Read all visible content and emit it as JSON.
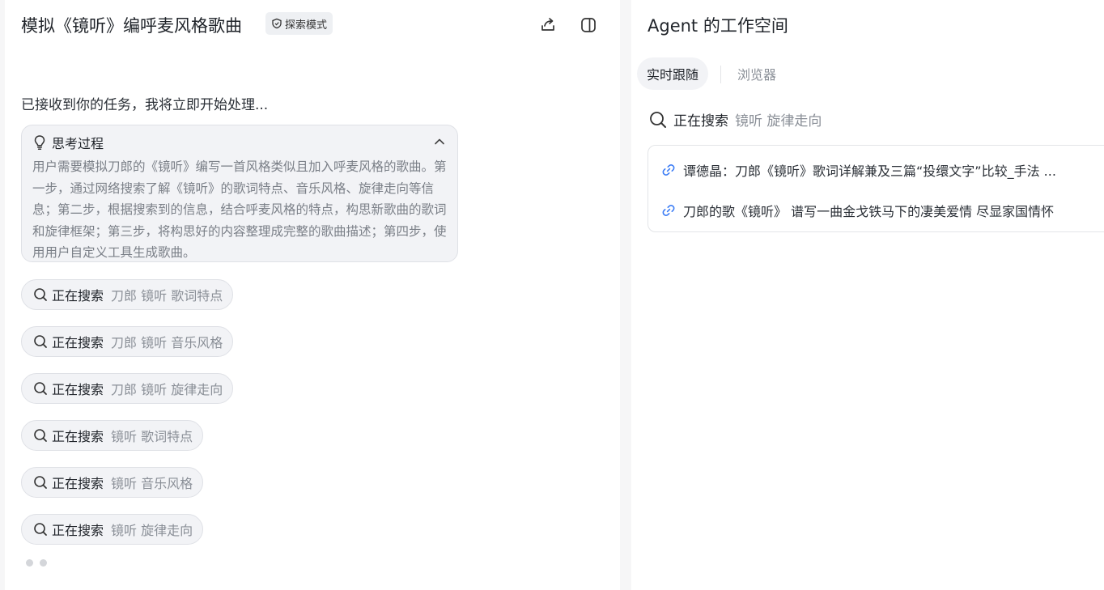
{
  "chat": {
    "title": "模拟《镜听》编呼麦风格歌曲",
    "mode_badge": "探索模式",
    "icons": {
      "share": "share-icon",
      "panel_toggle": "panel-toggle-icon"
    },
    "intro": "已接收到你的任务，我将立即开始处理...",
    "thinking": {
      "title": "思考过程",
      "body": "用户需要模拟刀郎的《镜听》编写一首风格类似且加入呼麦风格的歌曲。第一步，通过网络搜索了解《镜听》的歌词特点、音乐风格、旋律走向等信息；第二步，根据搜索到的信息，结合呼麦风格的特点，构思新歌曲的歌词和旋律框架；第三步，将构思好的内容整理成完整的歌曲描述；第四步，使用用户自定义工具生成歌曲。"
    },
    "searches": [
      {
        "verb": "正在搜索",
        "query": "刀郎 镜听 歌词特点"
      },
      {
        "verb": "正在搜索",
        "query": "刀郎 镜听 音乐风格"
      },
      {
        "verb": "正在搜索",
        "query": "刀郎 镜听 旋律走向"
      },
      {
        "verb": "正在搜索",
        "query": "镜听 歌词特点"
      },
      {
        "verb": "正在搜索",
        "query": "镜听 音乐风格"
      },
      {
        "verb": "正在搜索",
        "query": "镜听 旋律走向"
      }
    ]
  },
  "workspace": {
    "title": "Agent 的工作空间",
    "tabs": [
      {
        "label": "实时跟随",
        "active": true
      },
      {
        "label": "浏览器",
        "active": false
      }
    ],
    "search": {
      "verb": "正在搜索",
      "query": "镜听 旋律走向"
    },
    "results": [
      {
        "title": "谭德晶：刀郎《镜听》歌词详解兼及三篇“投缳文字”比较_手法 ..."
      },
      {
        "title": "刀郎的歌《镜听》 谱写一曲金戈铁马下的凄美爱情 尽显家国情怀"
      }
    ]
  },
  "colors": {
    "link_icon": "#3b7cf5",
    "muted_text": "#8a8f97",
    "pill_bg": "#f2f3f6"
  }
}
